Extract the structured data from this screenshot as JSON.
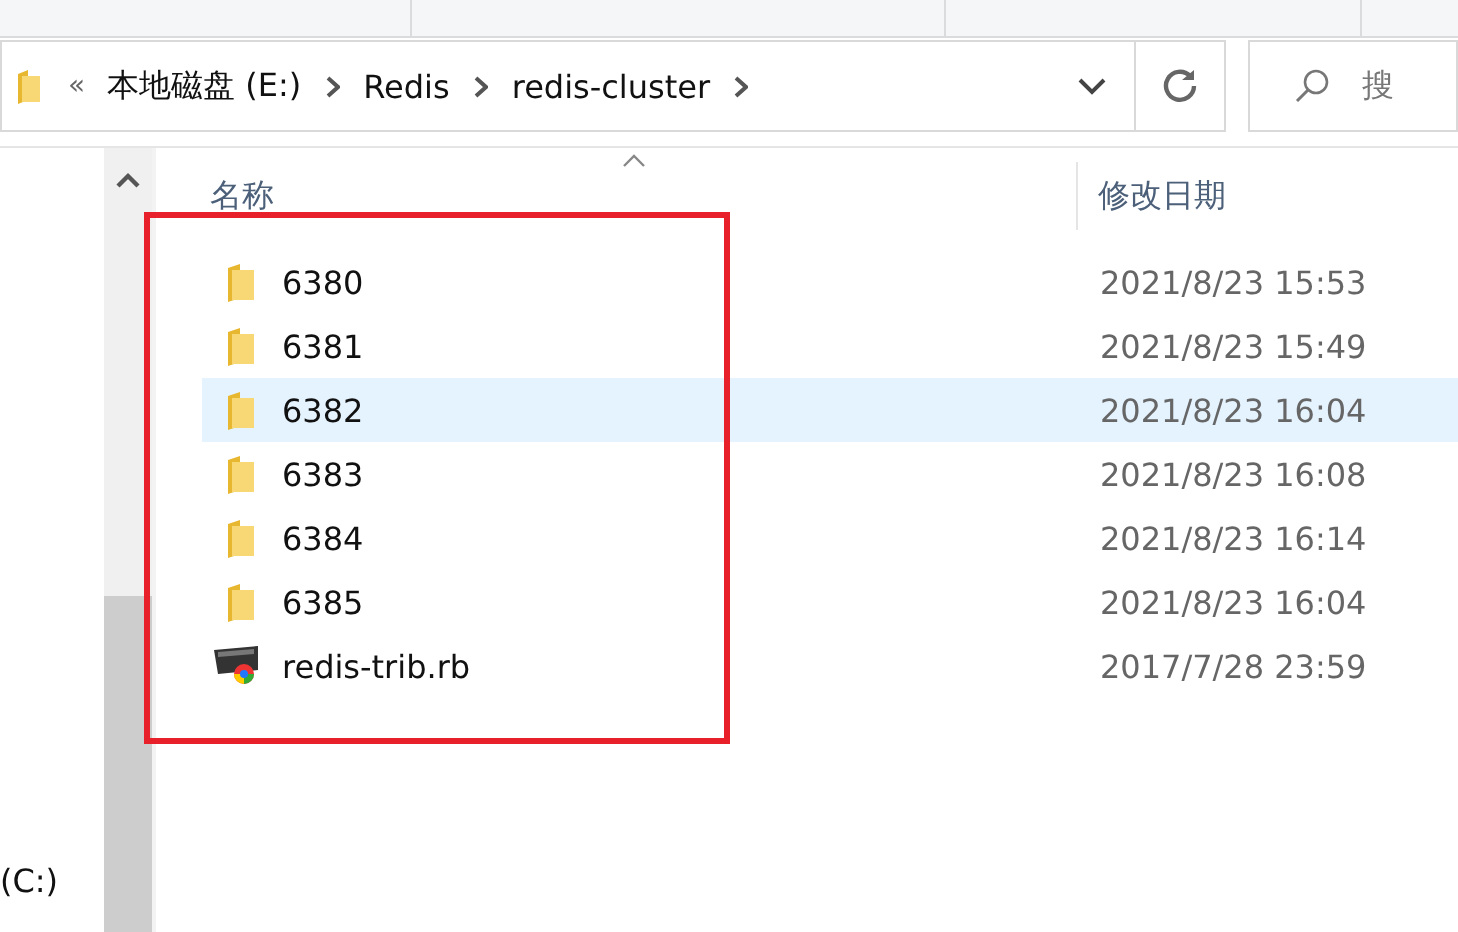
{
  "address_bar": {
    "overflow_mark": "«",
    "path": [
      "本地磁盘 (E:)",
      "Redis",
      "redis-cluster"
    ]
  },
  "search": {
    "placeholder": "搜"
  },
  "navigation": {
    "items": [
      {
        "label": "(C:)"
      }
    ]
  },
  "columns": [
    "名称",
    "修改日期"
  ],
  "files": [
    {
      "kind": "folder",
      "name": "6380",
      "modified": "2021/8/23 15:53",
      "selected": false
    },
    {
      "kind": "folder",
      "name": "6381",
      "modified": "2021/8/23 15:49",
      "selected": false
    },
    {
      "kind": "folder",
      "name": "6382",
      "modified": "2021/8/23 16:04",
      "selected": true
    },
    {
      "kind": "folder",
      "name": "6383",
      "modified": "2021/8/23 16:08",
      "selected": false
    },
    {
      "kind": "folder",
      "name": "6384",
      "modified": "2021/8/23 16:14",
      "selected": false
    },
    {
      "kind": "folder",
      "name": "6385",
      "modified": "2021/8/23 16:04",
      "selected": false
    },
    {
      "kind": "script",
      "name": "redis-trib.rb",
      "modified": "2017/7/28 23:59",
      "selected": false
    }
  ]
}
